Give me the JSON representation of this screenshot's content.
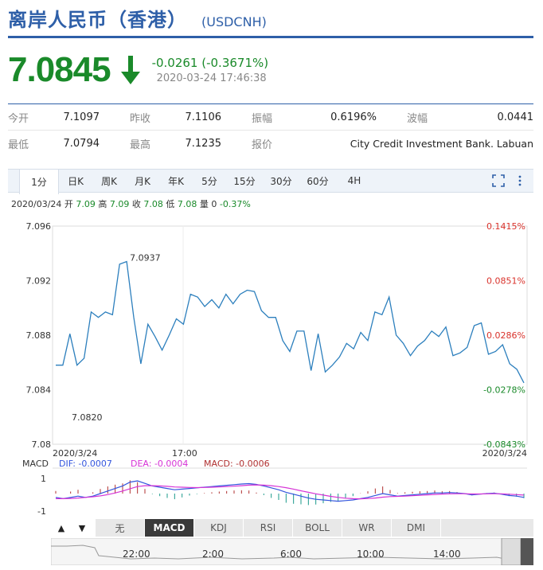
{
  "header": {
    "title": "离岸人民币（香港）",
    "code": "(USDCNH)"
  },
  "quote": {
    "price": "7.0845",
    "change": "-0.0261 (-0.3671%)",
    "time": "2020-03-24 17:46:38",
    "color_down": "#1a8a2a"
  },
  "stats": {
    "rows": [
      [
        {
          "label": "今开",
          "value": "7.1097"
        },
        {
          "label": "昨收",
          "value": "7.1106"
        },
        {
          "label": "振幅",
          "value": "0.6196%"
        },
        {
          "label": "波幅",
          "value": "0.0441"
        }
      ],
      [
        {
          "label": "最低",
          "value": "7.0794"
        },
        {
          "label": "最高",
          "value": "7.1235"
        },
        {
          "label": "报价",
          "value": "City Credit Investment Bank. Labuan"
        }
      ]
    ]
  },
  "tabs": [
    "1分",
    "日K",
    "周K",
    "月K",
    "年K",
    "5分",
    "15分",
    "30分",
    "60分",
    "4H"
  ],
  "active_tab": "1分",
  "ohlc": {
    "date": "2020/03/24",
    "open_label": "开",
    "open": "7.09",
    "high_label": "高",
    "high": "7.09",
    "close_label": "收",
    "close": "7.08",
    "low_label": "低",
    "low": "7.08",
    "vol_label": "量",
    "vol": "0",
    "pct": "-0.37%"
  },
  "chart_data": {
    "type": "line",
    "y_ticks": [
      "7.096",
      "7.092",
      "7.088",
      "7.084",
      "7.08"
    ],
    "y_tick_values": [
      7.096,
      7.092,
      7.088,
      7.084,
      7.08
    ],
    "pct_ticks": [
      "0.1415%",
      "0.0851%",
      "0.0286%",
      "-0.0278%",
      "-0.0843%"
    ],
    "ylim": [
      7.08,
      7.096
    ],
    "x_labels": {
      "start": "2020/3/24",
      "mid": "17:00",
      "end": "2020/3/24"
    },
    "annotations": {
      "max": "7.0937",
      "min": "7.0820"
    },
    "values": [
      7.0858,
      7.0858,
      7.0881,
      7.0858,
      7.0863,
      7.0897,
      7.0893,
      7.0897,
      7.0895,
      7.0932,
      7.0934,
      7.0893,
      7.0859,
      7.0888,
      7.0879,
      7.0869,
      7.088,
      7.0892,
      7.0888,
      7.091,
      7.0908,
      7.0901,
      7.0906,
      7.09,
      7.091,
      7.0903,
      7.091,
      7.0913,
      7.0912,
      7.0898,
      7.0893,
      7.0893,
      7.0876,
      7.0868,
      7.0883,
      7.0883,
      7.0854,
      7.0881,
      7.0853,
      7.0858,
      7.0864,
      7.0874,
      7.087,
      7.0882,
      7.0876,
      7.0897,
      7.0895,
      7.0908,
      7.088,
      7.0874,
      7.0865,
      7.0872,
      7.0876,
      7.0883,
      7.0879,
      7.0886,
      7.0865,
      7.0867,
      7.0871,
      7.0887,
      7.0889,
      7.0866,
      7.0868,
      7.0873,
      7.0859,
      7.0855,
      7.0845
    ],
    "line_color": "#2c7fbd",
    "pct_color_up": "#d9322b",
    "pct_color_down": "#1a8a2a"
  },
  "macd": {
    "label": "MACD",
    "dif_label": "DIF: -0.0007",
    "dea_label": "DEA: -0.0004",
    "macd_label": "MACD: -0.0006",
    "y_ticks": [
      "1",
      "-1"
    ],
    "dif_color": "#3355dd",
    "dea_color": "#d633d6",
    "macd_color": "#b03030",
    "dif": [
      -0.3,
      -0.4,
      -0.3,
      -0.2,
      -0.3,
      -0.2,
      0,
      0.2,
      0.4,
      0.6,
      0.9,
      1.0,
      0.8,
      0.6,
      0.5,
      0.4,
      0.3,
      0.35,
      0.4,
      0.45,
      0.5,
      0.55,
      0.6,
      0.65,
      0.7,
      0.75,
      0.78,
      0.72,
      0.6,
      0.45,
      0.3,
      0.1,
      -0.05,
      -0.2,
      -0.35,
      -0.45,
      -0.5,
      -0.55,
      -0.6,
      -0.55,
      -0.5,
      -0.4,
      -0.3,
      -0.15,
      0,
      -0.1,
      -0.2,
      -0.15,
      -0.1,
      -0.05,
      0,
      0.05,
      0.05,
      0.08,
      0.05,
      0,
      -0.1,
      -0.05,
      0,
      0.03,
      -0.05,
      -0.15,
      -0.2,
      -0.3
    ],
    "dea": [
      -0.4,
      -0.4,
      -0.38,
      -0.35,
      -0.3,
      -0.25,
      -0.18,
      -0.08,
      0.05,
      0.2,
      0.38,
      0.55,
      0.62,
      0.62,
      0.6,
      0.57,
      0.52,
      0.5,
      0.48,
      0.47,
      0.48,
      0.5,
      0.52,
      0.55,
      0.58,
      0.62,
      0.66,
      0.68,
      0.66,
      0.62,
      0.55,
      0.46,
      0.35,
      0.22,
      0.1,
      -0.02,
      -0.12,
      -0.22,
      -0.3,
      -0.36,
      -0.4,
      -0.41,
      -0.39,
      -0.35,
      -0.28,
      -0.24,
      -0.22,
      -0.2,
      -0.17,
      -0.14,
      -0.1,
      -0.07,
      -0.04,
      -0.02,
      -0.01,
      -0.01,
      -0.03,
      -0.03,
      -0.02,
      -0.01,
      -0.02,
      -0.05,
      -0.08,
      -0.12
    ]
  },
  "indicators": [
    "无",
    "MACD",
    "KDJ",
    "RSI",
    "BOLL",
    "WR",
    "DMI"
  ],
  "active_indicator": "MACD",
  "nav_arrows": [
    "▲",
    "▼"
  ],
  "timeline": {
    "labels": [
      "22:00",
      "2:00",
      "6:00",
      "10:00",
      "14:00"
    ]
  }
}
